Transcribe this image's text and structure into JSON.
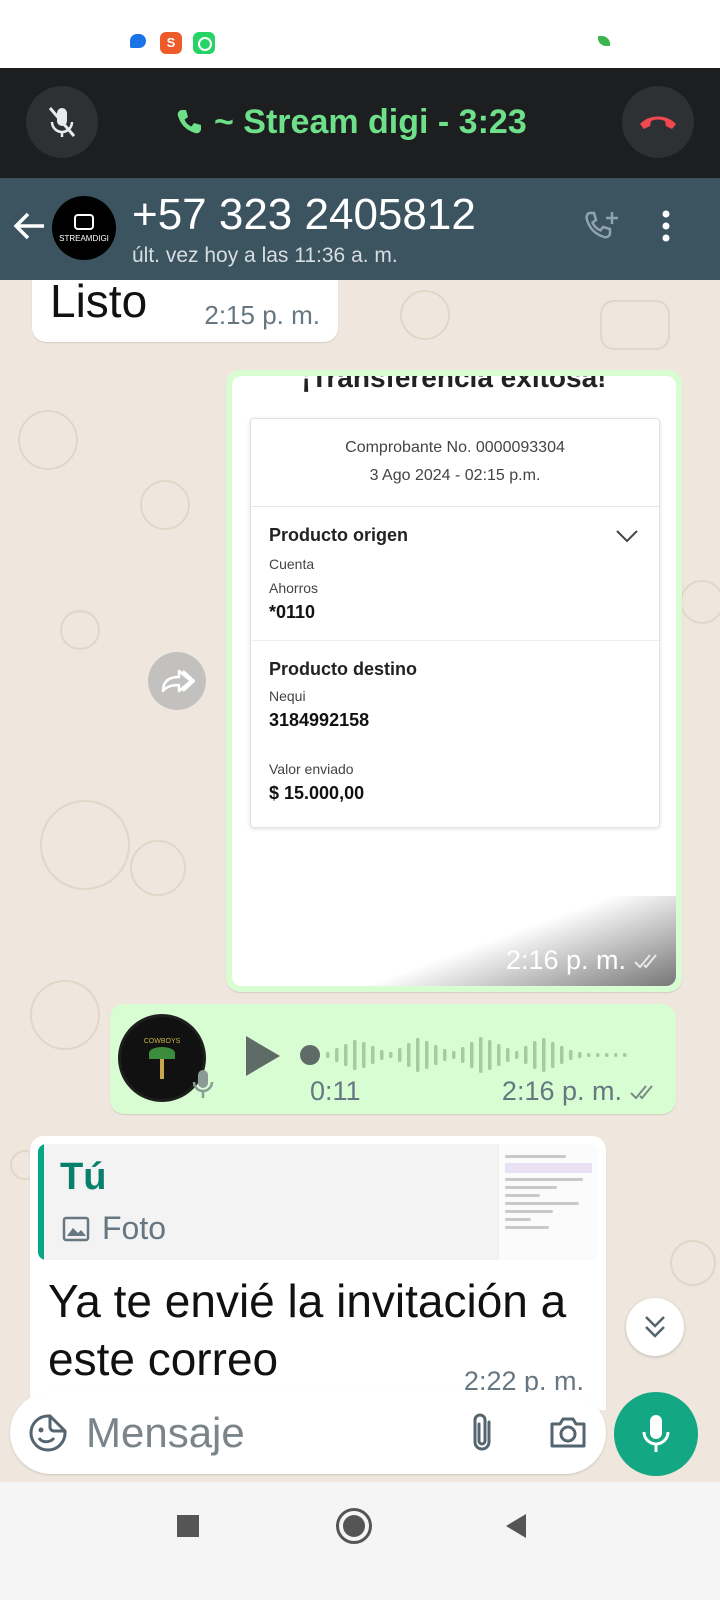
{
  "call": {
    "title": "~ Stream digi - 3:23",
    "accent_color": "#6fe08a"
  },
  "header": {
    "contact": "+57 323 2405812",
    "last_seen": "últ. vez hoy a las 11:36 a. m.",
    "avatar_text": "STREAMDIGI"
  },
  "messages": {
    "listo": {
      "text": "Listo",
      "time": "2:15 p. m."
    },
    "receipt": {
      "heading": "¡Transferencia exitosa!",
      "number": "Comprobante No. 0000093304",
      "date": "3 Ago 2024 - 02:15 p.m.",
      "origin_title": "Producto origen",
      "origin_type_label": "Cuenta",
      "origin_type": "Ahorros",
      "origin_account": "*0110",
      "dest_title": "Producto destino",
      "dest_bank": "Nequi",
      "dest_number": "3184992158",
      "amount_label": "Valor enviado",
      "amount": "$ 15.000,00",
      "time": "2:16 p. m."
    },
    "voice": {
      "duration": "0:11",
      "time": "2:16 p. m.",
      "avatar_text": "COWBOYS"
    },
    "reply": {
      "quote_author": "Tú",
      "quote_type": "Foto",
      "text": "Ya te envié la invitación a este correo",
      "time": "2:22 p. m."
    }
  },
  "composer": {
    "placeholder": "Mensaje"
  },
  "icons": {
    "mute": "mic-off-icon",
    "end_call": "call-end-icon",
    "back": "arrow-left-icon",
    "add_call": "add-call-icon",
    "menu": "more-vert-icon",
    "forward": "forward-icon",
    "play": "play-icon",
    "emoji": "sticker-icon",
    "attach": "paperclip-icon",
    "camera": "camera-icon",
    "mic": "mic-icon"
  }
}
